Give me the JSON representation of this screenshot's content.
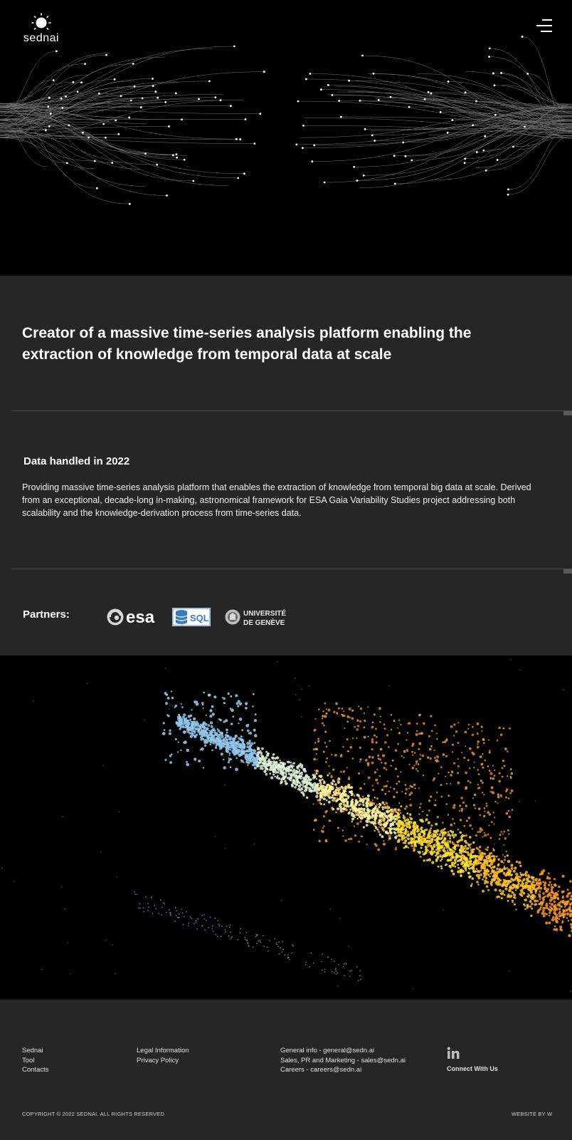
{
  "brand": {
    "name": "sednai",
    "logo_icon": "sun-icon"
  },
  "header": {
    "menu_icon": "menu-icon"
  },
  "intro": {
    "headline": "Creator of a massive time-series analysis platform enabling the extraction of knowledge from temporal data at scale"
  },
  "data_section": {
    "title": "Data handled in 2022",
    "text": "Providing massive time-series analysis platform that enables the extraction of knowledge from temporal big data at scale. Derived from an exceptional, decade-long in-making, astronomical framework for ESA Gaia Variability Studies project addressing both scalability and the knowledge-derivation process from time-series data."
  },
  "partners": {
    "label": "Partners:",
    "items": [
      {
        "name": "esa",
        "logo": "esa-logo"
      },
      {
        "name": "SQL",
        "logo": "sql-database-logo"
      },
      {
        "name": "UNIVERSITÉ DE GENÈVE",
        "line1": "UNIVERSITÉ",
        "line2": "DE GENÈVE",
        "logo": "unige-logo"
      }
    ]
  },
  "footer": {
    "col1": [
      "Sednai",
      "Tool",
      "Contacts"
    ],
    "col2": [
      "Legal Information",
      "Privacy Policy"
    ],
    "col3": [
      "General info - general@sedn.ai",
      "Sales, PR and Marketing - sales@sedn.ai",
      "Careers - careers@sedn.ai"
    ],
    "social_icon": "linkedin-icon",
    "connect": "Connect With Us",
    "copyright": "COPYRIGHT © 2022 SEDNAI. ALL RIGHTS RESERVED",
    "credit": "WEBSITE BY W"
  },
  "colors": {
    "hero_bg": "#000000",
    "section_bg": "#262626",
    "footer_bg": "#262626",
    "text": "#ffffff"
  }
}
